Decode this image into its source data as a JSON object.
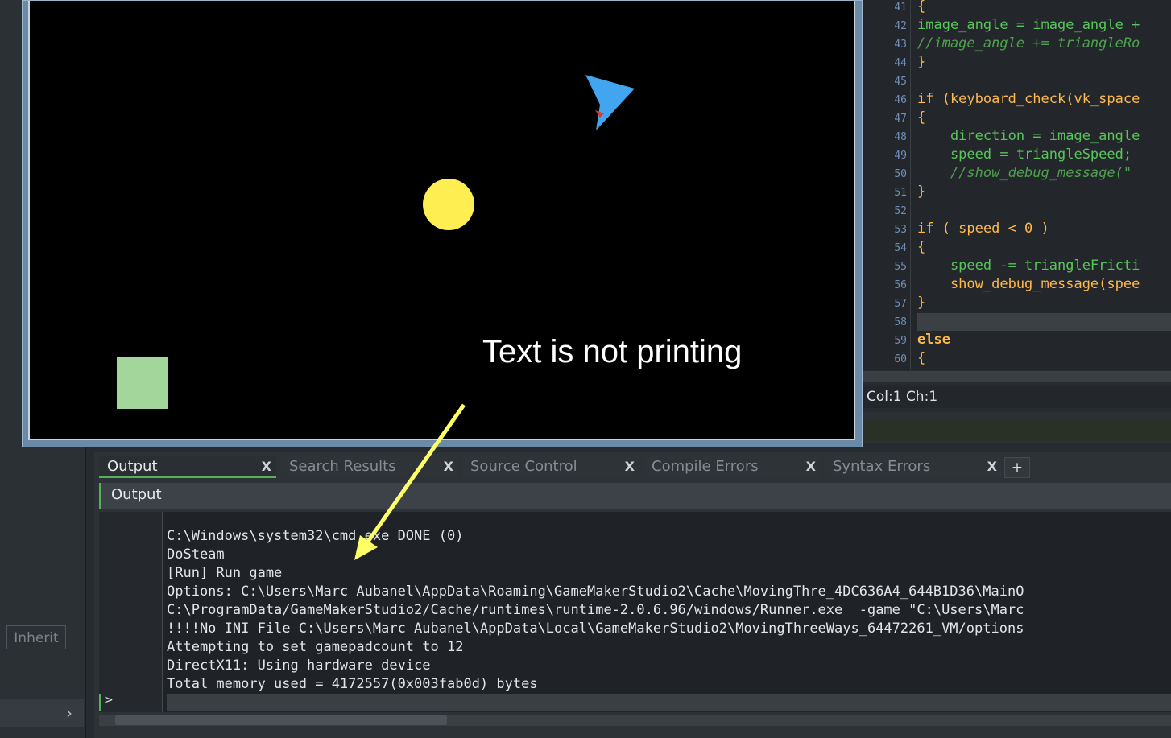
{
  "code_editor": {
    "lines": [
      {
        "n": "41",
        "code": "{"
      },
      {
        "n": "42",
        "code": "image_angle = image_angle +"
      },
      {
        "n": "43",
        "code": "//image_angle += triangleRo"
      },
      {
        "n": "44",
        "code": "}"
      },
      {
        "n": "45",
        "code": ""
      },
      {
        "n": "46",
        "code": "if (keyboard_check(vk_space"
      },
      {
        "n": "47",
        "code": "{"
      },
      {
        "n": "48",
        "code": "    direction = image_angle"
      },
      {
        "n": "49",
        "code": "    speed = triangleSpeed;"
      },
      {
        "n": "50",
        "code": "    //show_debug_message(\""
      },
      {
        "n": "51",
        "code": "}"
      },
      {
        "n": "52",
        "code": ""
      },
      {
        "n": "53",
        "code": "if ( speed < 0 )"
      },
      {
        "n": "54",
        "code": "{"
      },
      {
        "n": "55",
        "code": "    speed -= triangleFricti"
      },
      {
        "n": "56",
        "code": "    show_debug_message(spee"
      },
      {
        "n": "57",
        "code": "}"
      },
      {
        "n": "58",
        "code": ""
      },
      {
        "n": "59",
        "code": "else"
      },
      {
        "n": "60",
        "code": "{"
      }
    ],
    "status": "Col:1 Ch:1"
  },
  "game": {
    "annotation": "Text is not printing",
    "colors": {
      "background": "#000000",
      "triangle": "#42a5f0",
      "ball": "#ffee52",
      "square": "#a3d69a",
      "arrow": "#ffff66"
    }
  },
  "sidebar": {
    "inherit_label": "Inherit",
    "expander_icon": "chevron-right-icon"
  },
  "output": {
    "tabs": [
      {
        "label": "Output",
        "active": true
      },
      {
        "label": "Search Results",
        "active": false
      },
      {
        "label": "Source Control",
        "active": false
      },
      {
        "label": "Compile Errors",
        "active": false
      },
      {
        "label": "Syntax Errors",
        "active": false
      }
    ],
    "tab_close": "X",
    "add_tab": "+",
    "header": "Output",
    "console_lines": [
      "C:\\Windows\\system32\\cmd.exe DONE (0)",
      "DoSteam",
      "[Run] Run game",
      "Options: C:\\Users\\Marc Aubanel\\AppData\\Roaming\\GameMakerStudio2\\Cache\\MovingThre_4DC636A4_644B1D36\\MainO",
      "C:\\ProgramData/GameMakerStudio2/Cache/runtimes\\runtime-2.0.6.96/windows/Runner.exe  -game \"C:\\Users\\Marc",
      "!!!!No INI File C:\\Users\\Marc Aubanel\\AppData\\Local\\GameMakerStudio2\\MovingThreeWays_64472261_VM/options",
      "Attempting to set gamepadcount to 12",
      "DirectX11: Using hardware device",
      "Total memory used = 4172557(0x003fab0d) bytes"
    ],
    "prompt": ">"
  }
}
